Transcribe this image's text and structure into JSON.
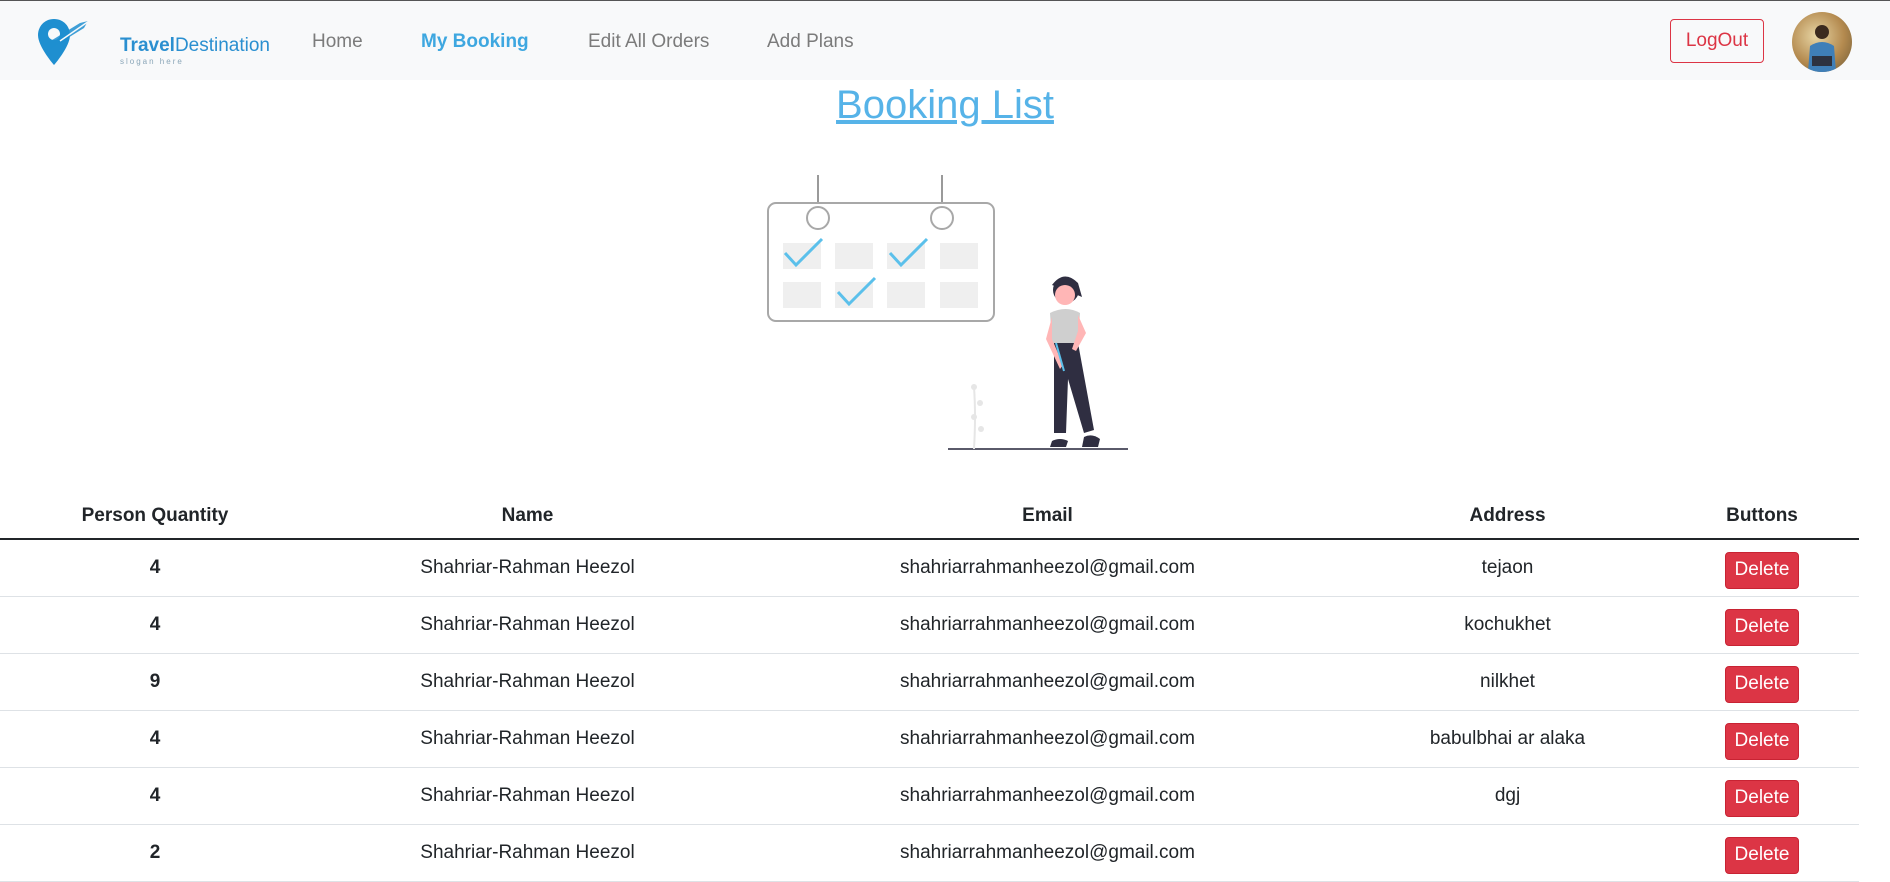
{
  "brand": {
    "name_bold": "Travel",
    "name_rest": "Destination",
    "slogan": "slogan here"
  },
  "nav": {
    "home": "Home",
    "my_booking": "My Booking",
    "edit_orders": "Edit All Orders",
    "add_plans": "Add Plans",
    "logout": "LogOut"
  },
  "page": {
    "title": "Booking List"
  },
  "table": {
    "headers": [
      "Person Quantity",
      "Name",
      "Email",
      "Address",
      "Buttons"
    ],
    "rows": [
      {
        "qty": "4",
        "name": "Shahriar-Rahman Heezol",
        "email": "shahriarrahmanheezol@gmail.com",
        "address": "tejaon",
        "button": "Delete"
      },
      {
        "qty": "4",
        "name": "Shahriar-Rahman Heezol",
        "email": "shahriarrahmanheezol@gmail.com",
        "address": "kochukhet",
        "button": "Delete"
      },
      {
        "qty": "9",
        "name": "Shahriar-Rahman Heezol",
        "email": "shahriarrahmanheezol@gmail.com",
        "address": "nilkhet",
        "button": "Delete"
      },
      {
        "qty": "4",
        "name": "Shahriar-Rahman Heezol",
        "email": "shahriarrahmanheezol@gmail.com",
        "address": "babulbhai ar alaka",
        "button": "Delete"
      },
      {
        "qty": "4",
        "name": "Shahriar-Rahman Heezol",
        "email": "shahriarrahmanheezol@gmail.com",
        "address": "dgj",
        "button": "Delete"
      },
      {
        "qty": "2",
        "name": "Shahriar-Rahman Heezol",
        "email": "shahriarrahmanheezol@gmail.com",
        "address": "",
        "button": "Delete"
      }
    ]
  },
  "colors": {
    "accent": "#3ea7e0",
    "danger": "#dc3545",
    "navbar_bg": "#f8f9fa"
  }
}
